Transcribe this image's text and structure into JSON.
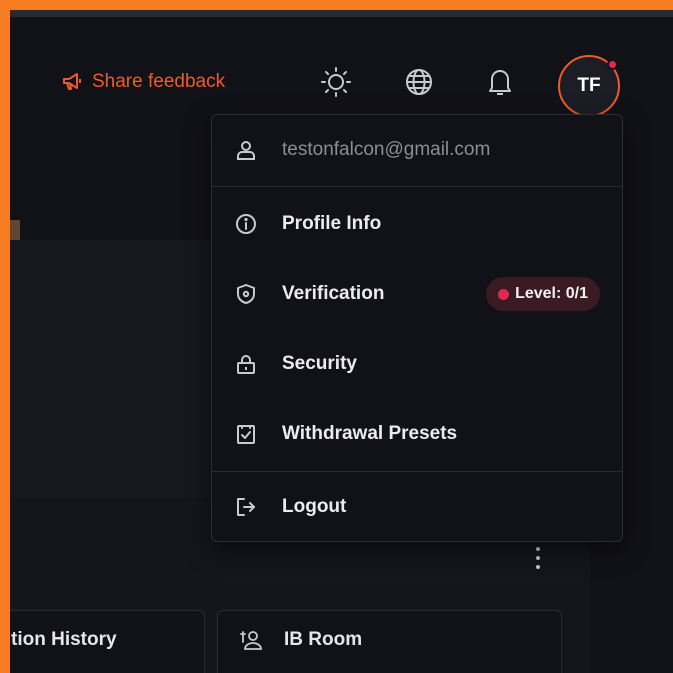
{
  "header": {
    "feedback_label": "Share feedback",
    "feedback_icon": "megaphone-icon",
    "icons": [
      "sun-icon",
      "globe-icon",
      "bell-icon"
    ],
    "avatar_initials": "TF"
  },
  "menu": {
    "email": "testonfalcon@gmail.com",
    "items": [
      {
        "label": "Profile Info",
        "icon": "info-icon"
      },
      {
        "label": "Verification",
        "icon": "shield-icon",
        "badge": "Level: 0/1"
      },
      {
        "label": "Security",
        "icon": "lock-icon"
      },
      {
        "label": "Withdrawal Presets",
        "icon": "checklist-icon"
      }
    ],
    "logout_label": "Logout"
  },
  "cards": {
    "left_label": "tion History",
    "right_label": "IB Room"
  },
  "colors": {
    "accent": "#ef5a2a",
    "frame": "#f57c21",
    "background": "#111118",
    "badge_dot": "#e2284f"
  }
}
